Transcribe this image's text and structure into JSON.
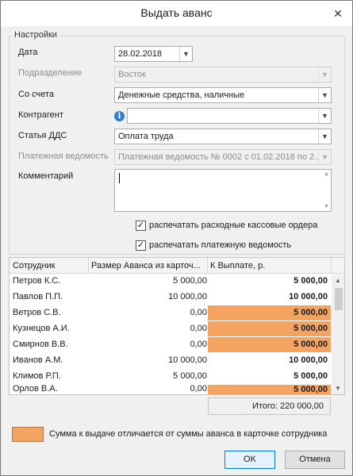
{
  "window": {
    "title": "Выдать аванс"
  },
  "settings": {
    "legend": "Настройки",
    "date": {
      "label": "Дата",
      "value": "28.02.2018"
    },
    "department": {
      "label": "Подразделение",
      "value": "Восток"
    },
    "from_account": {
      "label": "Со счета",
      "value": "Денежные средства, наличные"
    },
    "counterparty": {
      "label": "Контрагент",
      "value": ""
    },
    "cashflow_item": {
      "label": "Статья ДДС",
      "value": "Оплата труда"
    },
    "payroll_sheet": {
      "label": "Платежная ведомость",
      "value": "Платежная ведомость № 0002 с 01.02.2018 по 2..."
    },
    "comment": {
      "label": "Комментарий",
      "value": ""
    },
    "print_cash_orders": {
      "label": "распечатать расходные кассовые ордера",
      "checked": true
    },
    "print_payroll": {
      "label": "распечатать платежную ведомость",
      "checked": true
    }
  },
  "table": {
    "columns": [
      "Сотрудник",
      "Размер Аванса из карточ...",
      "К Выплате, р."
    ],
    "rows": [
      {
        "name": "Петров К.С.",
        "advance": "5 000,00",
        "payout": "5 000,00",
        "highlight": false
      },
      {
        "name": "Павлов П.П.",
        "advance": "10 000,00",
        "payout": "10 000,00",
        "highlight": false
      },
      {
        "name": "Ветров С.В.",
        "advance": "0,00",
        "payout": "5 000,00",
        "highlight": true
      },
      {
        "name": "Кузнецов А.И.",
        "advance": "0,00",
        "payout": "5 000,00",
        "highlight": true
      },
      {
        "name": "Смирнов В.В.",
        "advance": "0,00",
        "payout": "5 000,00",
        "highlight": true
      },
      {
        "name": "Иванов А.М.",
        "advance": "10 000,00",
        "payout": "10 000,00",
        "highlight": false
      },
      {
        "name": "Климов Р.П.",
        "advance": "5 000,00",
        "payout": "5 000,00",
        "highlight": false
      },
      {
        "name": "Орлов В.А.",
        "advance": "0,00",
        "payout": "5 000,00",
        "highlight": true
      }
    ],
    "total": "Итого: 220 000,00"
  },
  "legend_note": {
    "text": "Сумма к выдаче отличается от суммы аванса в карточке сотрудника",
    "color": "#f4a460"
  },
  "buttons": {
    "ok": "OK",
    "cancel": "Отмена"
  }
}
